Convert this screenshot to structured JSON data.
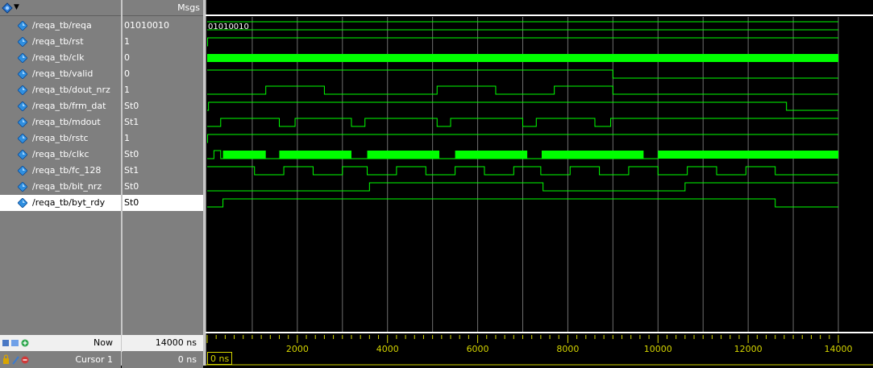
{
  "header": {
    "msgs_label": "Msgs"
  },
  "signals": [
    {
      "name": "/reqa_tb/reqa",
      "value": "01010010"
    },
    {
      "name": "/reqa_tb/rst",
      "value": "1"
    },
    {
      "name": "/reqa_tb/clk",
      "value": "0"
    },
    {
      "name": "/reqa_tb/valid",
      "value": "0"
    },
    {
      "name": "/reqa_tb/dout_nrz",
      "value": "1"
    },
    {
      "name": "/reqa_tb/frm_dat",
      "value": "St0"
    },
    {
      "name": "/reqa_tb/mdout",
      "value": "St1"
    },
    {
      "name": "/reqa_tb/rstc",
      "value": "1"
    },
    {
      "name": "/reqa_tb/clkc",
      "value": "St0"
    },
    {
      "name": "/reqa_tb/fc_128",
      "value": "St1"
    },
    {
      "name": "/reqa_tb/bit_nrz",
      "value": "St0"
    },
    {
      "name": "/reqa_tb/byt_rdy",
      "value": "St0"
    }
  ],
  "selected_signal": "/reqa_tb/byt_rdy",
  "bus_label": "01010010",
  "footer": {
    "now_label": "Now",
    "now_value": "14000 ns",
    "cursor_label": "Cursor 1",
    "cursor_value": "0 ns",
    "cursor_box": "0 ns"
  },
  "timeline": {
    "unit": "ns",
    "start": 0,
    "end": 14000,
    "tick_labels": [
      "2000",
      "4000",
      "6000",
      "8000",
      "10000",
      "12000",
      "14000"
    ]
  },
  "waveforms": {
    "rst": [
      [
        0,
        0
      ],
      [
        10,
        1
      ]
    ],
    "valid": [
      [
        0,
        1
      ],
      [
        9000,
        0
      ]
    ],
    "dout_nrz": [
      [
        0,
        0
      ],
      [
        1300,
        1
      ],
      [
        2600,
        0
      ],
      [
        5100,
        1
      ],
      [
        6400,
        0
      ],
      [
        7700,
        1
      ],
      [
        9000,
        0
      ]
    ],
    "frm_dat": [
      [
        0,
        0
      ],
      [
        30,
        1
      ],
      [
        12850,
        0
      ]
    ],
    "mdout": [
      [
        0,
        0
      ],
      [
        300,
        1
      ],
      [
        1600,
        0
      ],
      [
        1950,
        1
      ],
      [
        3200,
        0
      ],
      [
        3500,
        1
      ],
      [
        5100,
        0
      ],
      [
        5400,
        1
      ],
      [
        7000,
        0
      ],
      [
        7300,
        1
      ],
      [
        8600,
        0
      ],
      [
        8950,
        1
      ]
    ],
    "clkc": [
      [
        0,
        0
      ],
      [
        150,
        1
      ],
      [
        300,
        0
      ],
      [
        350,
        "clk"
      ],
      [
        1300,
        0
      ],
      [
        1600,
        "clk"
      ],
      [
        3200,
        0
      ],
      [
        3550,
        "clk"
      ],
      [
        5150,
        0
      ],
      [
        5500,
        "clk"
      ],
      [
        7100,
        0
      ],
      [
        7420,
        "clk"
      ],
      [
        9680,
        0
      ],
      [
        10000,
        "clk"
      ]
    ],
    "fc_128": [
      [
        0,
        1
      ],
      [
        1050,
        0
      ],
      [
        1700,
        1
      ],
      [
        2350,
        0
      ],
      [
        3000,
        1
      ],
      [
        3550,
        0
      ],
      [
        4200,
        1
      ],
      [
        4850,
        0
      ],
      [
        5500,
        1
      ],
      [
        6150,
        0
      ],
      [
        6800,
        1
      ],
      [
        7400,
        0
      ],
      [
        8050,
        1
      ],
      [
        8700,
        0
      ],
      [
        9350,
        1
      ],
      [
        10000,
        0
      ],
      [
        10650,
        1
      ],
      [
        11300,
        0
      ],
      [
        11950,
        1
      ],
      [
        12600,
        0
      ]
    ],
    "bit_nrz": [
      [
        0,
        0
      ],
      [
        3600,
        1
      ],
      [
        7450,
        0
      ],
      [
        10600,
        1
      ]
    ],
    "byt_rdy": [
      [
        0,
        0
      ],
      [
        350,
        1
      ],
      [
        12600,
        0
      ]
    ]
  },
  "colors": {
    "wave": "#00ff00",
    "grid": "#6e6e6e",
    "ruler": "#d4d400",
    "pane_bg": "#7f7f7f",
    "wave_bg": "#000000"
  },
  "icons": {
    "signal": "diamond-signal-icon",
    "header": "wave-window-icon"
  }
}
